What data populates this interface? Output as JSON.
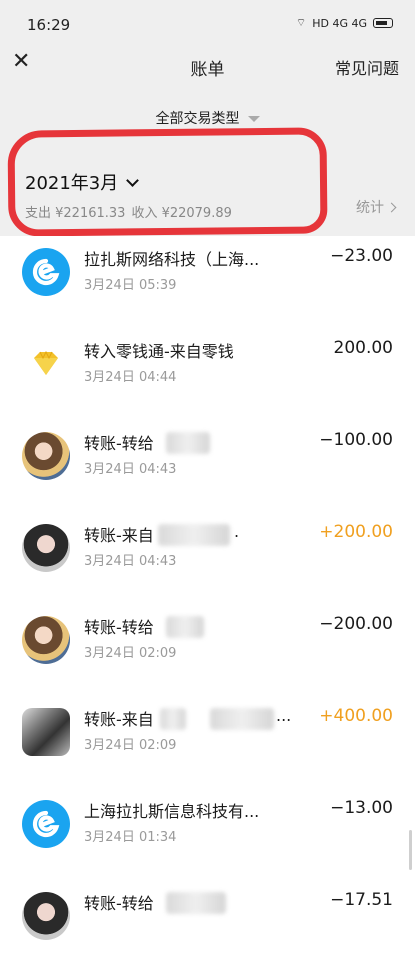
{
  "status_bar": {
    "time": "16:29",
    "icons": "HD 4G 4G"
  },
  "nav": {
    "title": "账单",
    "faq": "常见问题"
  },
  "filter": {
    "label": "全部交易类型"
  },
  "month": {
    "label": "2021年3月",
    "expense": "支出 ¥22161.33",
    "income": "收入 ¥22079.89",
    "stats": "统计"
  },
  "transactions": [
    {
      "title": "拉扎斯网络科技（上海...",
      "time": "3月24日 05:39",
      "amount": "−23.00",
      "type": "expense",
      "icon": "ele-me-logo-icon"
    },
    {
      "title": "转入零钱通-来自零钱",
      "time": "3月24日 04:44",
      "amount": "200.00",
      "type": "neutral",
      "icon": "diamond-icon"
    },
    {
      "title": "转账-转给",
      "time": "3月24日 04:43",
      "amount": "−100.00",
      "type": "expense",
      "icon": "avatar-photo"
    },
    {
      "title": "转账-来自",
      "title_tail": ".",
      "time": "3月24日 04:43",
      "amount": "+200.00",
      "type": "income",
      "icon": "avatar-photo"
    },
    {
      "title": "转账-转给",
      "time": "3月24日 02:09",
      "amount": "−200.00",
      "type": "expense",
      "icon": "avatar-photo"
    },
    {
      "title": "转账-来自",
      "title_tail": "...",
      "time": "3月24日 02:09",
      "amount": "+400.00",
      "type": "income",
      "icon": "avatar-photo"
    },
    {
      "title": "上海拉扎斯信息科技有...",
      "time": "3月24日 01:34",
      "amount": "−13.00",
      "type": "expense",
      "icon": "ele-me-logo-icon"
    },
    {
      "title": "转账-转给",
      "time": "",
      "amount": "−17.51",
      "type": "expense",
      "icon": "avatar-photo"
    }
  ],
  "colors": {
    "accent_income": "#f0a020",
    "highlight": "#e6353a",
    "ele_blue": "#1aa4f0"
  }
}
